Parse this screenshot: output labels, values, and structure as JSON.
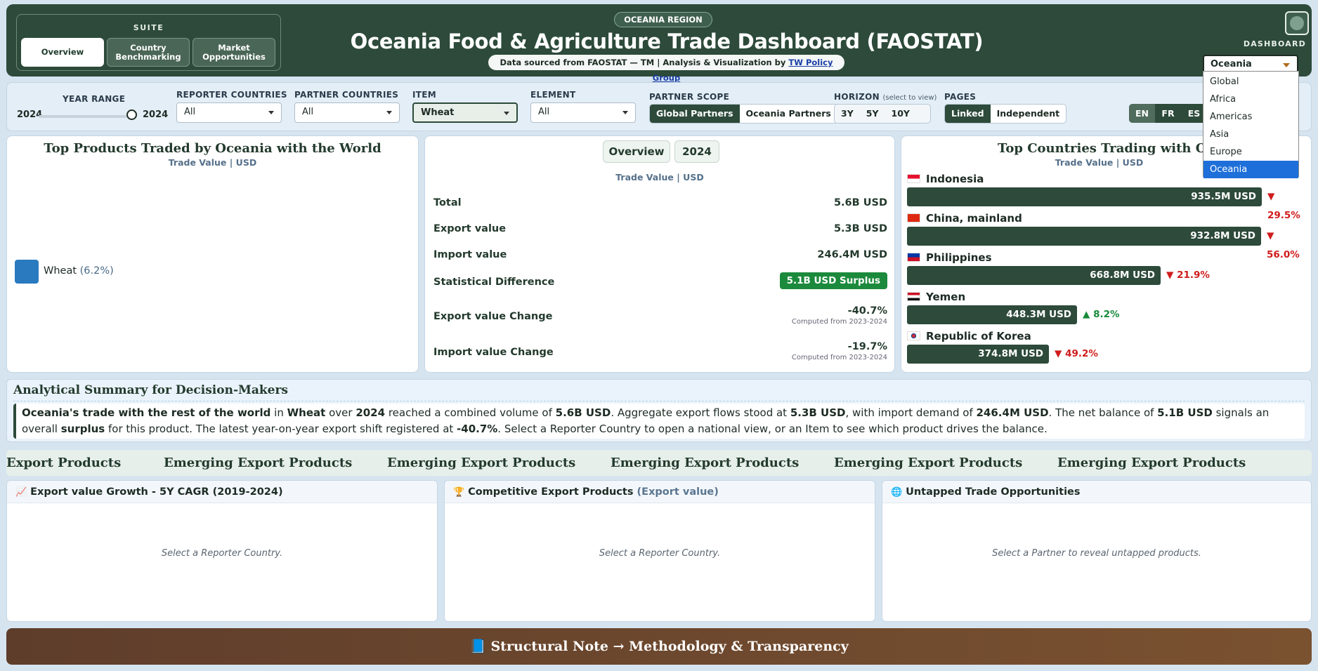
{
  "header": {
    "suite_title": "SUITE",
    "suite_tabs": [
      "Overview",
      "Country Benchmarking",
      "Market Opportunities"
    ],
    "region_pill": "OCEANIA REGION",
    "title": "Oceania Food & Agriculture Trade Dashboard (FAOSTAT)",
    "source_text": "Data sourced from FAOSTAT — TM | Analysis & Visualization by",
    "source_link": "TW Policy Group",
    "dashboard_label": "DASHBOARD",
    "dashboard_selected": "Oceania",
    "dashboard_options": [
      "Global",
      "Africa",
      "Americas",
      "Asia",
      "Europe",
      "Oceania"
    ]
  },
  "filters": {
    "year_range_label": "YEAR RANGE",
    "year_from": "2024",
    "year_to": "2024",
    "reporter_label": "REPORTER COUNTRIES",
    "reporter_value": "All",
    "partner_label": "PARTNER COUNTRIES",
    "partner_value": "All",
    "item_label": "ITEM",
    "item_value": "Wheat",
    "element_label": "ELEMENT",
    "element_value": "All",
    "scope_label": "PARTNER SCOPE",
    "scope_options": [
      "Global Partners",
      "Oceania Partners"
    ],
    "horizon_label": "HORIZON",
    "horizon_hint": "(select to view)",
    "horizon_options": [
      "3Y",
      "5Y",
      "10Y"
    ],
    "pages_label": "PAGES",
    "pages_options": [
      "Linked",
      "Independent"
    ],
    "languages": [
      "EN",
      "FR",
      "ES"
    ]
  },
  "products_panel": {
    "title": "Top Products Traded by Oceania with the World",
    "subtitle": "Trade Value | USD",
    "legend_item": "Wheat",
    "legend_pct": "(6.2%)",
    "legend_color": "#2a7abf"
  },
  "overview_panel": {
    "tabs": [
      "Overview",
      "2024"
    ],
    "subtitle": "Trade Value | USD",
    "rows": [
      {
        "label": "Total",
        "value": "5.6B USD"
      },
      {
        "label": "Export value",
        "value": "5.3B USD"
      },
      {
        "label": "Import value",
        "value": "246.4M USD"
      },
      {
        "label": "Statistical Difference",
        "value": "5.1B USD Surplus"
      },
      {
        "label": "Export value Change",
        "value": "-40.7%",
        "note": "Computed from 2023-2024"
      },
      {
        "label": "Import value Change",
        "value": "-19.7%",
        "note": "Computed from 2023-2024"
      }
    ]
  },
  "countries_panel": {
    "title": "Top Countries Trading with Ocean",
    "subtitle": "Trade Value | USD",
    "countries": [
      {
        "name": "Indonesia",
        "value": "935.5M USD",
        "change": "▼ 29.5%",
        "direction": "down",
        "amount": 935.5
      },
      {
        "name": "China, mainland",
        "value": "932.8M USD",
        "change": "▼ 56.0%",
        "direction": "down",
        "amount": 932.8
      },
      {
        "name": "Philippines",
        "value": "668.8M USD",
        "change": "▼ 21.9%",
        "direction": "down",
        "amount": 668.8
      },
      {
        "name": "Yemen",
        "value": "448.3M USD",
        "change": "▲ 8.2%",
        "direction": "up",
        "amount": 448.3
      },
      {
        "name": "Republic of Korea",
        "value": "374.8M USD",
        "change": "▼ 49.2%",
        "direction": "down",
        "amount": 374.8
      }
    ]
  },
  "summary": {
    "title": "Analytical Summary for Decision-Makers",
    "parts": [
      {
        "t": "Oceania's trade with the rest of the world",
        "b": true
      },
      {
        "t": " in ",
        "b": false
      },
      {
        "t": "Wheat",
        "b": true
      },
      {
        "t": " over ",
        "b": false
      },
      {
        "t": "2024",
        "b": true
      },
      {
        "t": " reached a combined volume of ",
        "b": false
      },
      {
        "t": "5.6B USD",
        "b": true
      },
      {
        "t": ". Aggregate export flows stood at ",
        "b": false
      },
      {
        "t": "5.3B USD",
        "b": true
      },
      {
        "t": ", with import demand of ",
        "b": false
      },
      {
        "t": "246.4M USD",
        "b": true
      },
      {
        "t": ". The net balance of ",
        "b": false
      },
      {
        "t": "5.1B USD",
        "b": true
      },
      {
        "t": " signals an overall ",
        "b": false
      },
      {
        "t": "surplus",
        "b": true
      },
      {
        "t": " for this product. The latest year-on-year export shift registered at ",
        "b": false
      },
      {
        "t": "-40.7%",
        "b": true
      },
      {
        "t": ". Select a Reporter Country to open a national view, or an Item to see which product drives the balance.",
        "b": false
      }
    ]
  },
  "ticker": [
    "Export Products",
    "Emerging Export Products",
    "Emerging Export Products",
    "Emerging Export Products",
    "Emerging Export Products",
    "Emerging Export Products"
  ],
  "bottom_panels": [
    {
      "icon": "📈",
      "title": "Export value Growth - 5Y CAGR (2019-2024)",
      "muted": "",
      "empty": "Select a Reporter Country."
    },
    {
      "icon": "🏆",
      "title": "Competitive Export Products",
      "muted": "(Export value)",
      "empty": "Select a Reporter Country."
    },
    {
      "icon": "🌐",
      "title": "Untapped Trade Opportunities",
      "muted": "",
      "empty": "Select a Partner to reveal untapped products."
    }
  ],
  "footer": {
    "label": "📘 Structural Note → Methodology & Transparency"
  }
}
